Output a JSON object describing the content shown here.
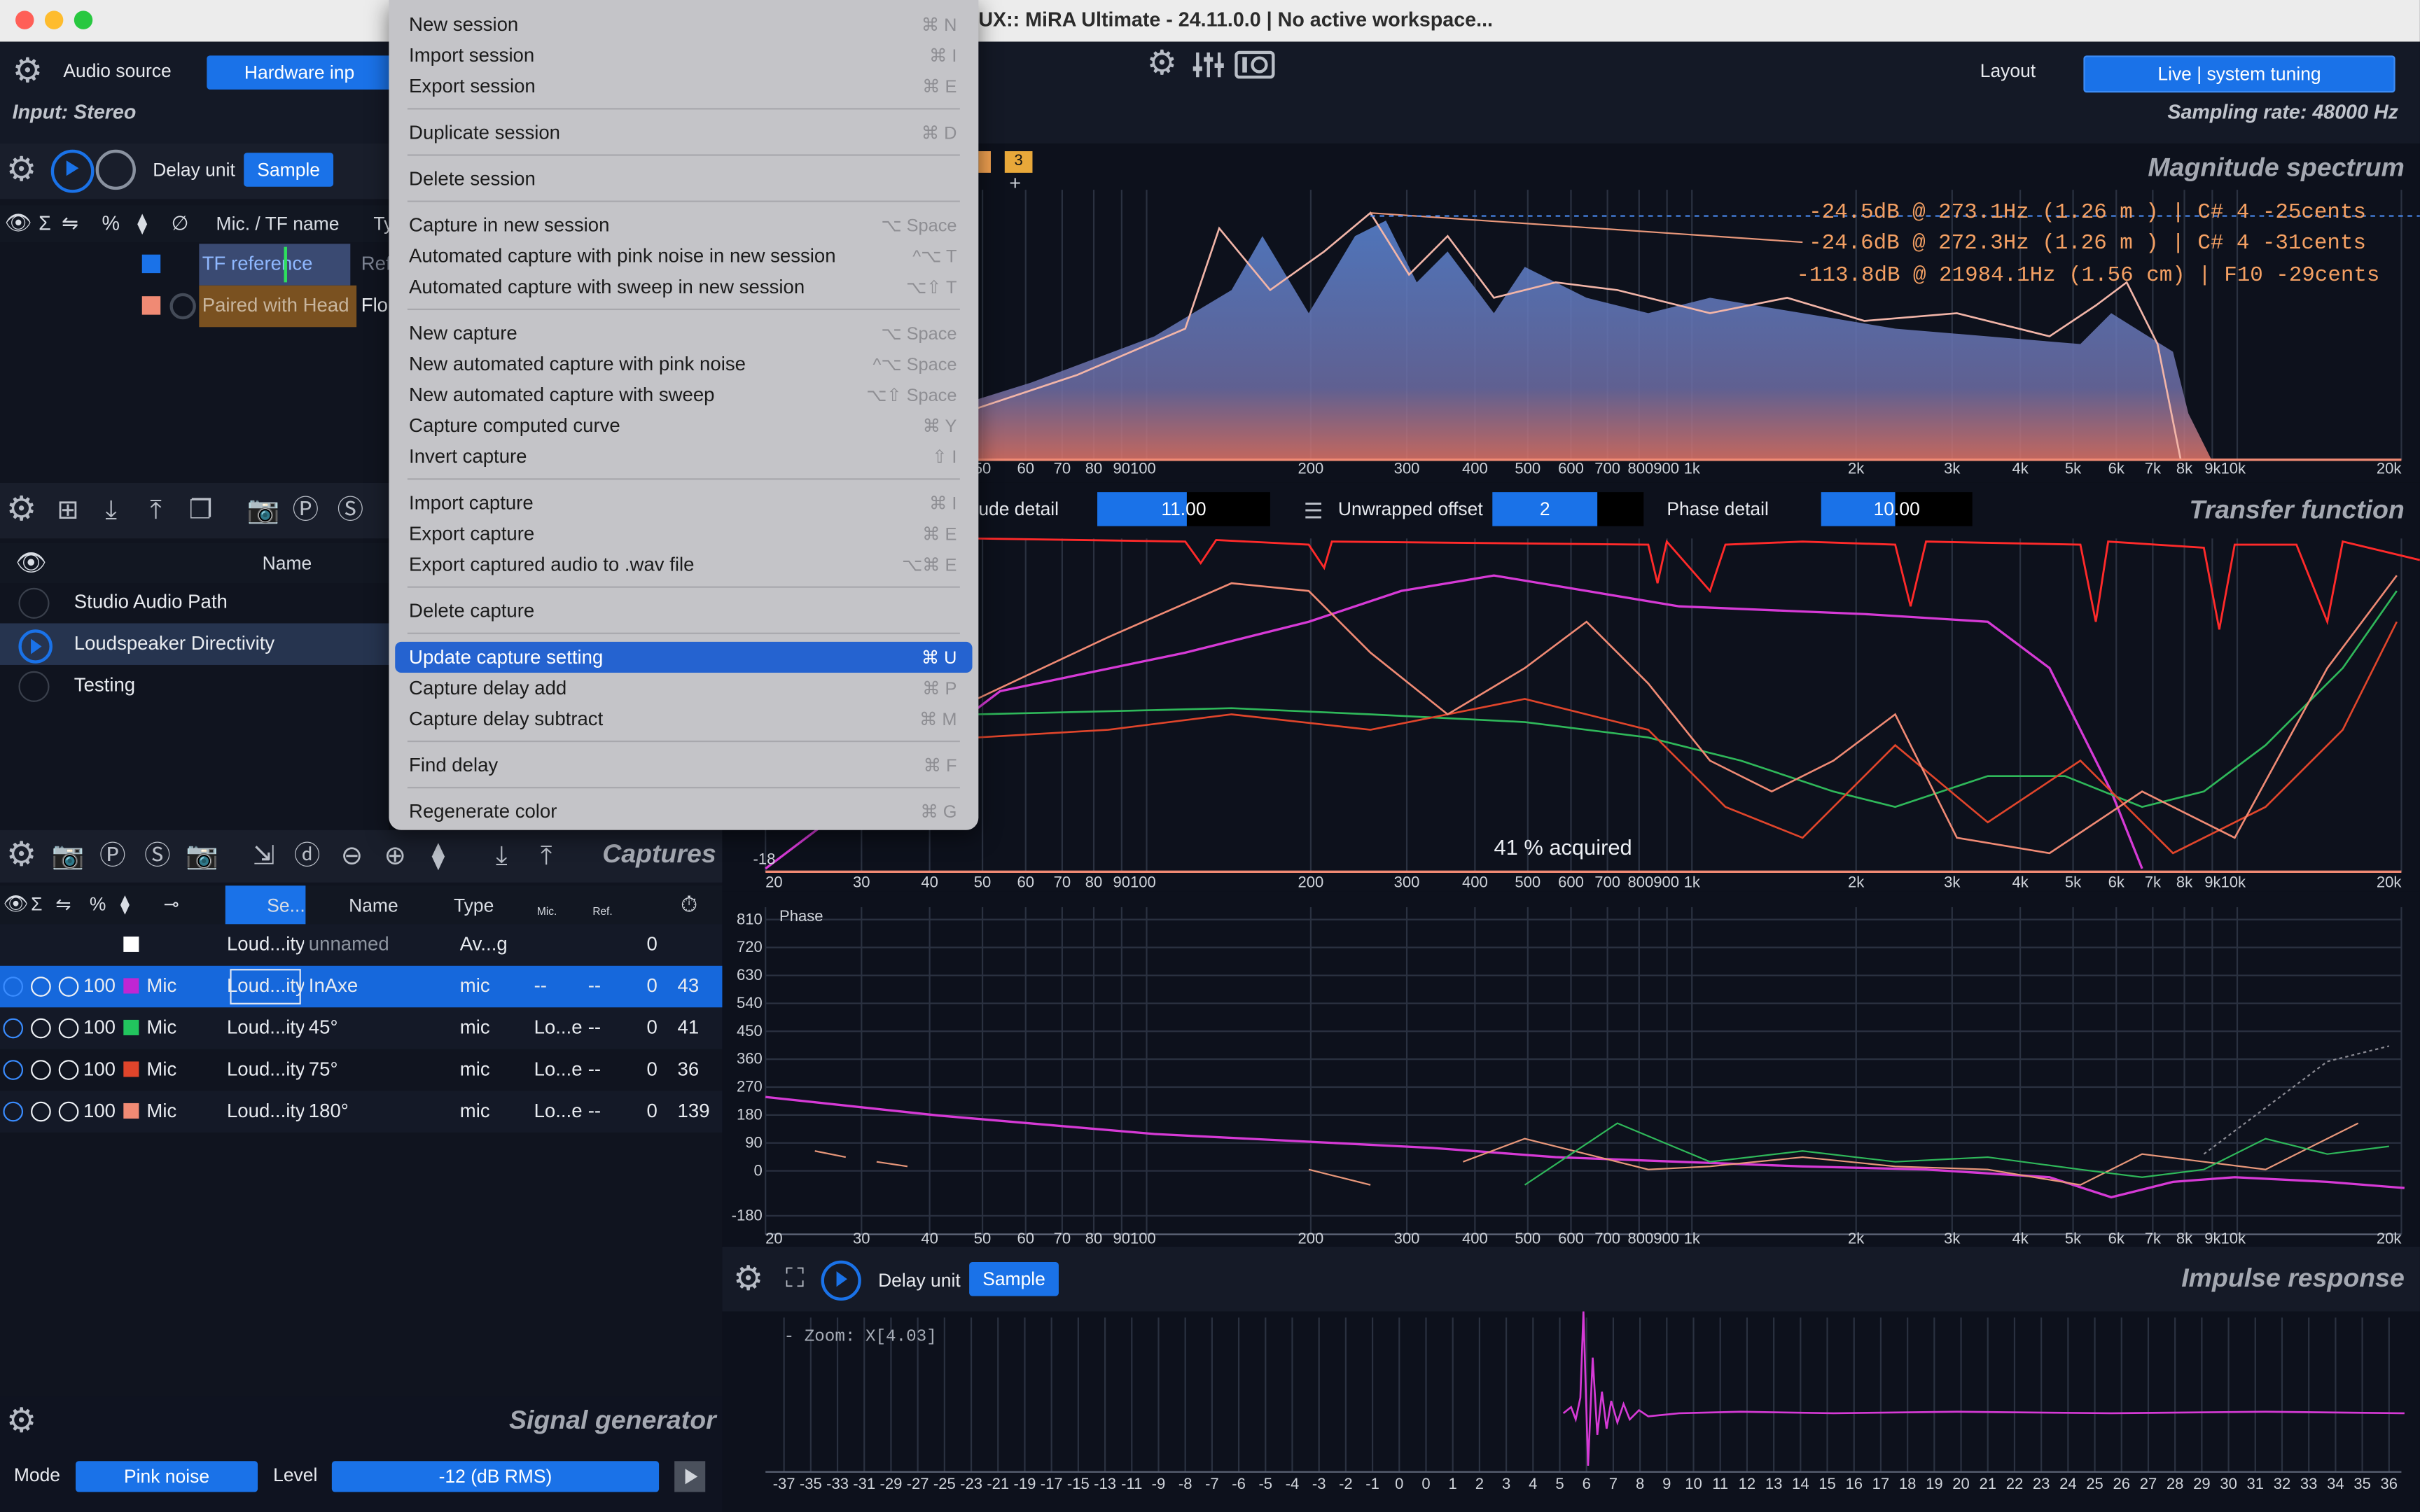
{
  "window": {
    "title": "UX:: MiRA Ultimate - 24.11.0.0 | No active workspace..."
  },
  "top_bar": {
    "audio_source_label": "Audio source",
    "hardware_input_label": "Hardware inp",
    "input_label": "Input: Stereo",
    "layout_label": "Layout",
    "layout_value": "Live | system tuning",
    "sampling_rate": "Sampling rate: 48000 Hz"
  },
  "tf_panel": {
    "delay_unit_label": "Delay unit",
    "delay_unit_value": "Sample",
    "columns": [
      "Mic. / TF name",
      "Ty"
    ],
    "rows": [
      {
        "name": "TF reference",
        "type": "Ref",
        "color": "#1a72e8"
      },
      {
        "name": "Paired with Head",
        "type": "Flo",
        "color": "#e8806a"
      }
    ]
  },
  "sessions": {
    "column_name": "Name",
    "items": [
      {
        "name": "Studio Audio Path",
        "selected": false
      },
      {
        "name": "Loudspeaker Directivity",
        "selected": true
      },
      {
        "name": "Testing",
        "selected": false
      }
    ]
  },
  "captures": {
    "title": "Captures",
    "columns": [
      "Se...",
      "Name",
      "Type",
      "Mic.",
      "Ref."
    ],
    "rows": [
      {
        "vol": "",
        "kind": "",
        "session": "Loud...ity",
        "name": "unnamed",
        "type": "Av...ge",
        "mic": "",
        "ref": "",
        "delay": "0",
        "time": "",
        "color": "#ffffff",
        "selected": false
      },
      {
        "vol": "100",
        "kind": "Mic",
        "session": "Loud...ity",
        "name": "InAxe",
        "type": "mic",
        "mic": "--",
        "ref": "--",
        "delay": "0",
        "time": "43",
        "color": "#c026d3",
        "selected": true
      },
      {
        "vol": "100",
        "kind": "Mic",
        "session": "Loud...ity",
        "name": "45°",
        "type": "mic",
        "mic": "Lo...e",
        "ref": "--",
        "delay": "0",
        "time": "41",
        "color": "#22c55e",
        "selected": false
      },
      {
        "vol": "100",
        "kind": "Mic",
        "session": "Loud...ity",
        "name": "75°",
        "type": "mic",
        "mic": "Lo...e",
        "ref": "--",
        "delay": "0",
        "time": "36",
        "color": "#e0452b",
        "selected": false
      },
      {
        "vol": "100",
        "kind": "Mic",
        "session": "Loud...ity",
        "name": "180°",
        "type": "mic",
        "mic": "Lo...e",
        "ref": "--",
        "delay": "0",
        "time": "139",
        "color": "#f08a74",
        "selected": false
      }
    ]
  },
  "signal_generator": {
    "title": "Signal generator",
    "mode_label": "Mode",
    "mode_value": "Pink noise",
    "level_label": "Level",
    "level_value": "-12 (dB RMS)"
  },
  "magnitude": {
    "title": "Magnitude spectrum",
    "tab_number": "3",
    "readouts": [
      "-24.5dB @   273.1Hz (1.26 m ) | C# 4 -25cents",
      "-24.6dB @   272.3Hz (1.26 m ) | C# 4 -31cents",
      "-113.8dB @ 21984.1Hz (1.56 cm) |  F10 -29cents"
    ]
  },
  "freq_ticks": [
    "20",
    "30",
    "40",
    "50",
    "60",
    "70",
    "80",
    "90100",
    "200",
    "300",
    "400",
    "500",
    "600",
    "700",
    "800900",
    "1k",
    "2k",
    "3k",
    "4k",
    "5k",
    "6k",
    "7k",
    "8k",
    "9k10k",
    "20k"
  ],
  "transfer": {
    "title": "Transfer function",
    "magnitude_detail_label": "ude detail",
    "magnitude_detail_value": "11.00",
    "unwrapped_offset_label": "Unwrapped offset",
    "unwrapped_offset_value": "2",
    "phase_detail_label": "Phase detail",
    "phase_detail_value": "10.00",
    "acquired_text": "41 % acquired",
    "left_tick": "-18"
  },
  "phase": {
    "label": "Phase",
    "ticks": [
      "810",
      "720",
      "630",
      "540",
      "450",
      "360",
      "270",
      "180",
      "90",
      "0",
      "-180"
    ]
  },
  "impulse": {
    "title": "Impulse response",
    "delay_unit_label": "Delay unit",
    "delay_unit_value": "Sample",
    "zoom_text": "- Zoom: X[4.03]",
    "ticks": [
      "-37",
      "-35",
      "-33",
      "-31",
      "-29",
      "-27",
      "-25",
      "-23",
      "-21",
      "-19",
      "-17",
      "-15",
      "-13",
      "-11",
      "-9",
      "-8",
      "-7",
      "-6",
      "-5",
      "-4",
      "-3",
      "-2",
      "-1",
      "0",
      "0",
      "1",
      "2",
      "3",
      "4",
      "5",
      "6",
      "7",
      "8",
      "9",
      "10",
      "11",
      "12",
      "13",
      "14",
      "15",
      "16",
      "17",
      "18",
      "19",
      "20",
      "21",
      "22",
      "23",
      "24",
      "25",
      "26",
      "27",
      "28",
      "29",
      "30",
      "31",
      "32",
      "33",
      "34",
      "35",
      "36"
    ]
  },
  "menu": {
    "groups": [
      [
        {
          "label": "New session",
          "shortcut": "⌘ N"
        },
        {
          "label": "Import session",
          "shortcut": "⌘ I"
        },
        {
          "label": "Export session",
          "shortcut": "⌘ E"
        }
      ],
      [
        {
          "label": "Duplicate session",
          "shortcut": "⌘ D"
        }
      ],
      [
        {
          "label": "Delete session",
          "shortcut": ""
        }
      ],
      [
        {
          "label": "Capture in new session",
          "shortcut": "⌥ Space"
        },
        {
          "label": "Automated capture with pink noise in new session",
          "shortcut": "^⌥ T"
        },
        {
          "label": "Automated capture with sweep in new session",
          "shortcut": "⌥⇧ T"
        }
      ],
      [
        {
          "label": "New capture",
          "shortcut": "⌥ Space"
        },
        {
          "label": "New automated capture with pink noise",
          "shortcut": "^⌥ Space"
        },
        {
          "label": "New automated capture with sweep",
          "shortcut": "⌥⇧ Space"
        },
        {
          "label": "Capture computed curve",
          "shortcut": "⌘ Y"
        },
        {
          "label": "Invert capture",
          "shortcut": "⇧ I"
        }
      ],
      [
        {
          "label": "Import capture",
          "shortcut": "⌘ I"
        },
        {
          "label": "Export capture",
          "shortcut": "⌘ E"
        },
        {
          "label": "Export captured audio to .wav file",
          "shortcut": "⌥⌘ E"
        }
      ],
      [
        {
          "label": "Delete capture",
          "shortcut": ""
        }
      ],
      [
        {
          "label": "Update capture setting",
          "shortcut": "⌘ U",
          "selected": true
        },
        {
          "label": "Capture delay add",
          "shortcut": "⌘ P"
        },
        {
          "label": "Capture delay subtract",
          "shortcut": "⌘ M"
        }
      ],
      [
        {
          "label": "Find delay",
          "shortcut": "⌘ F"
        }
      ],
      [
        {
          "label": "Regenerate color",
          "shortcut": "⌘ G"
        }
      ]
    ]
  },
  "colors": {
    "accent": "#1a72e8",
    "capture_magenta": "#c026d3",
    "capture_green": "#22c55e",
    "capture_red": "#e0452b",
    "capture_salmon": "#f08a74",
    "readout_orange": "#f4a063"
  }
}
